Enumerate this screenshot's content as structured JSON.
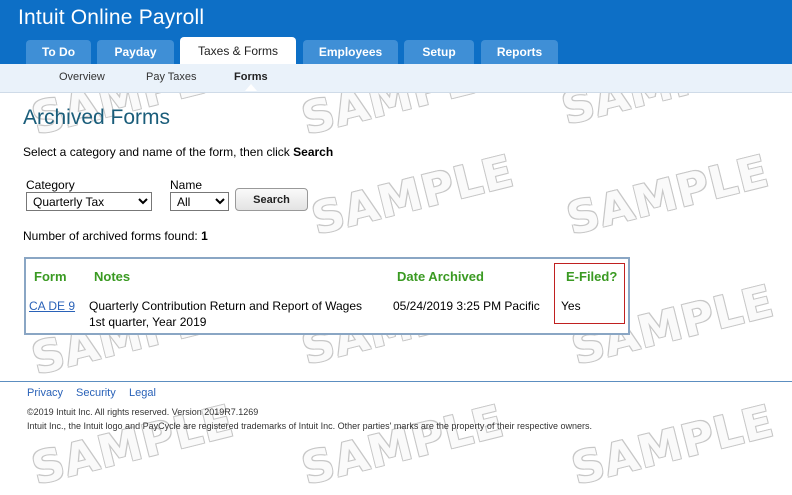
{
  "app": {
    "title": "Intuit Online Payroll"
  },
  "tabs": [
    {
      "label": "To Do"
    },
    {
      "label": "Payday"
    },
    {
      "label": "Taxes & Forms"
    },
    {
      "label": "Employees"
    },
    {
      "label": "Setup"
    },
    {
      "label": "Reports"
    }
  ],
  "active_tab": "Taxes & Forms",
  "subnav": [
    {
      "label": "Overview"
    },
    {
      "label": "Pay Taxes"
    },
    {
      "label": "Forms"
    }
  ],
  "active_subnav": "Forms",
  "page": {
    "title": "Archived Forms",
    "instruction_prefix": "Select a category and name of the form, then click ",
    "instruction_bold": "Search"
  },
  "filters": {
    "category_label": "Category",
    "category_value": "Quarterly Tax",
    "name_label": "Name",
    "name_value": "All",
    "search_label": "Search"
  },
  "results": {
    "count_label": "Number of archived forms found: ",
    "count": "1",
    "columns": [
      "Form",
      "Notes",
      "Date Archived",
      "E-Filed?"
    ],
    "rows": [
      {
        "form": "CA DE 9",
        "notes_line1": "Quarterly Contribution Return and Report of Wages",
        "notes_line2": "1st quarter, Year 2019",
        "date_archived": "05/24/2019 3:25 PM Pacific",
        "efiled": "Yes"
      }
    ]
  },
  "footer": {
    "links": [
      "Privacy",
      "Security",
      "Legal"
    ],
    "copyright": "©2019 Intuit Inc. All rights reserved. Version 2019R7.1269",
    "trademark": "Intuit Inc., the Intuit logo and PayCycle are registered trademarks of Intuit Inc. Other parties' marks are the property of their respective owners."
  },
  "watermark": "SAMPLE",
  "colors": {
    "header_blue": "#0d6fc6",
    "tab_blue": "#3f8fd6",
    "column_header_green": "#3a9a22",
    "highlight_red": "#c02020",
    "title_teal": "#1a5d7a",
    "link_blue": "#2a62b8"
  }
}
